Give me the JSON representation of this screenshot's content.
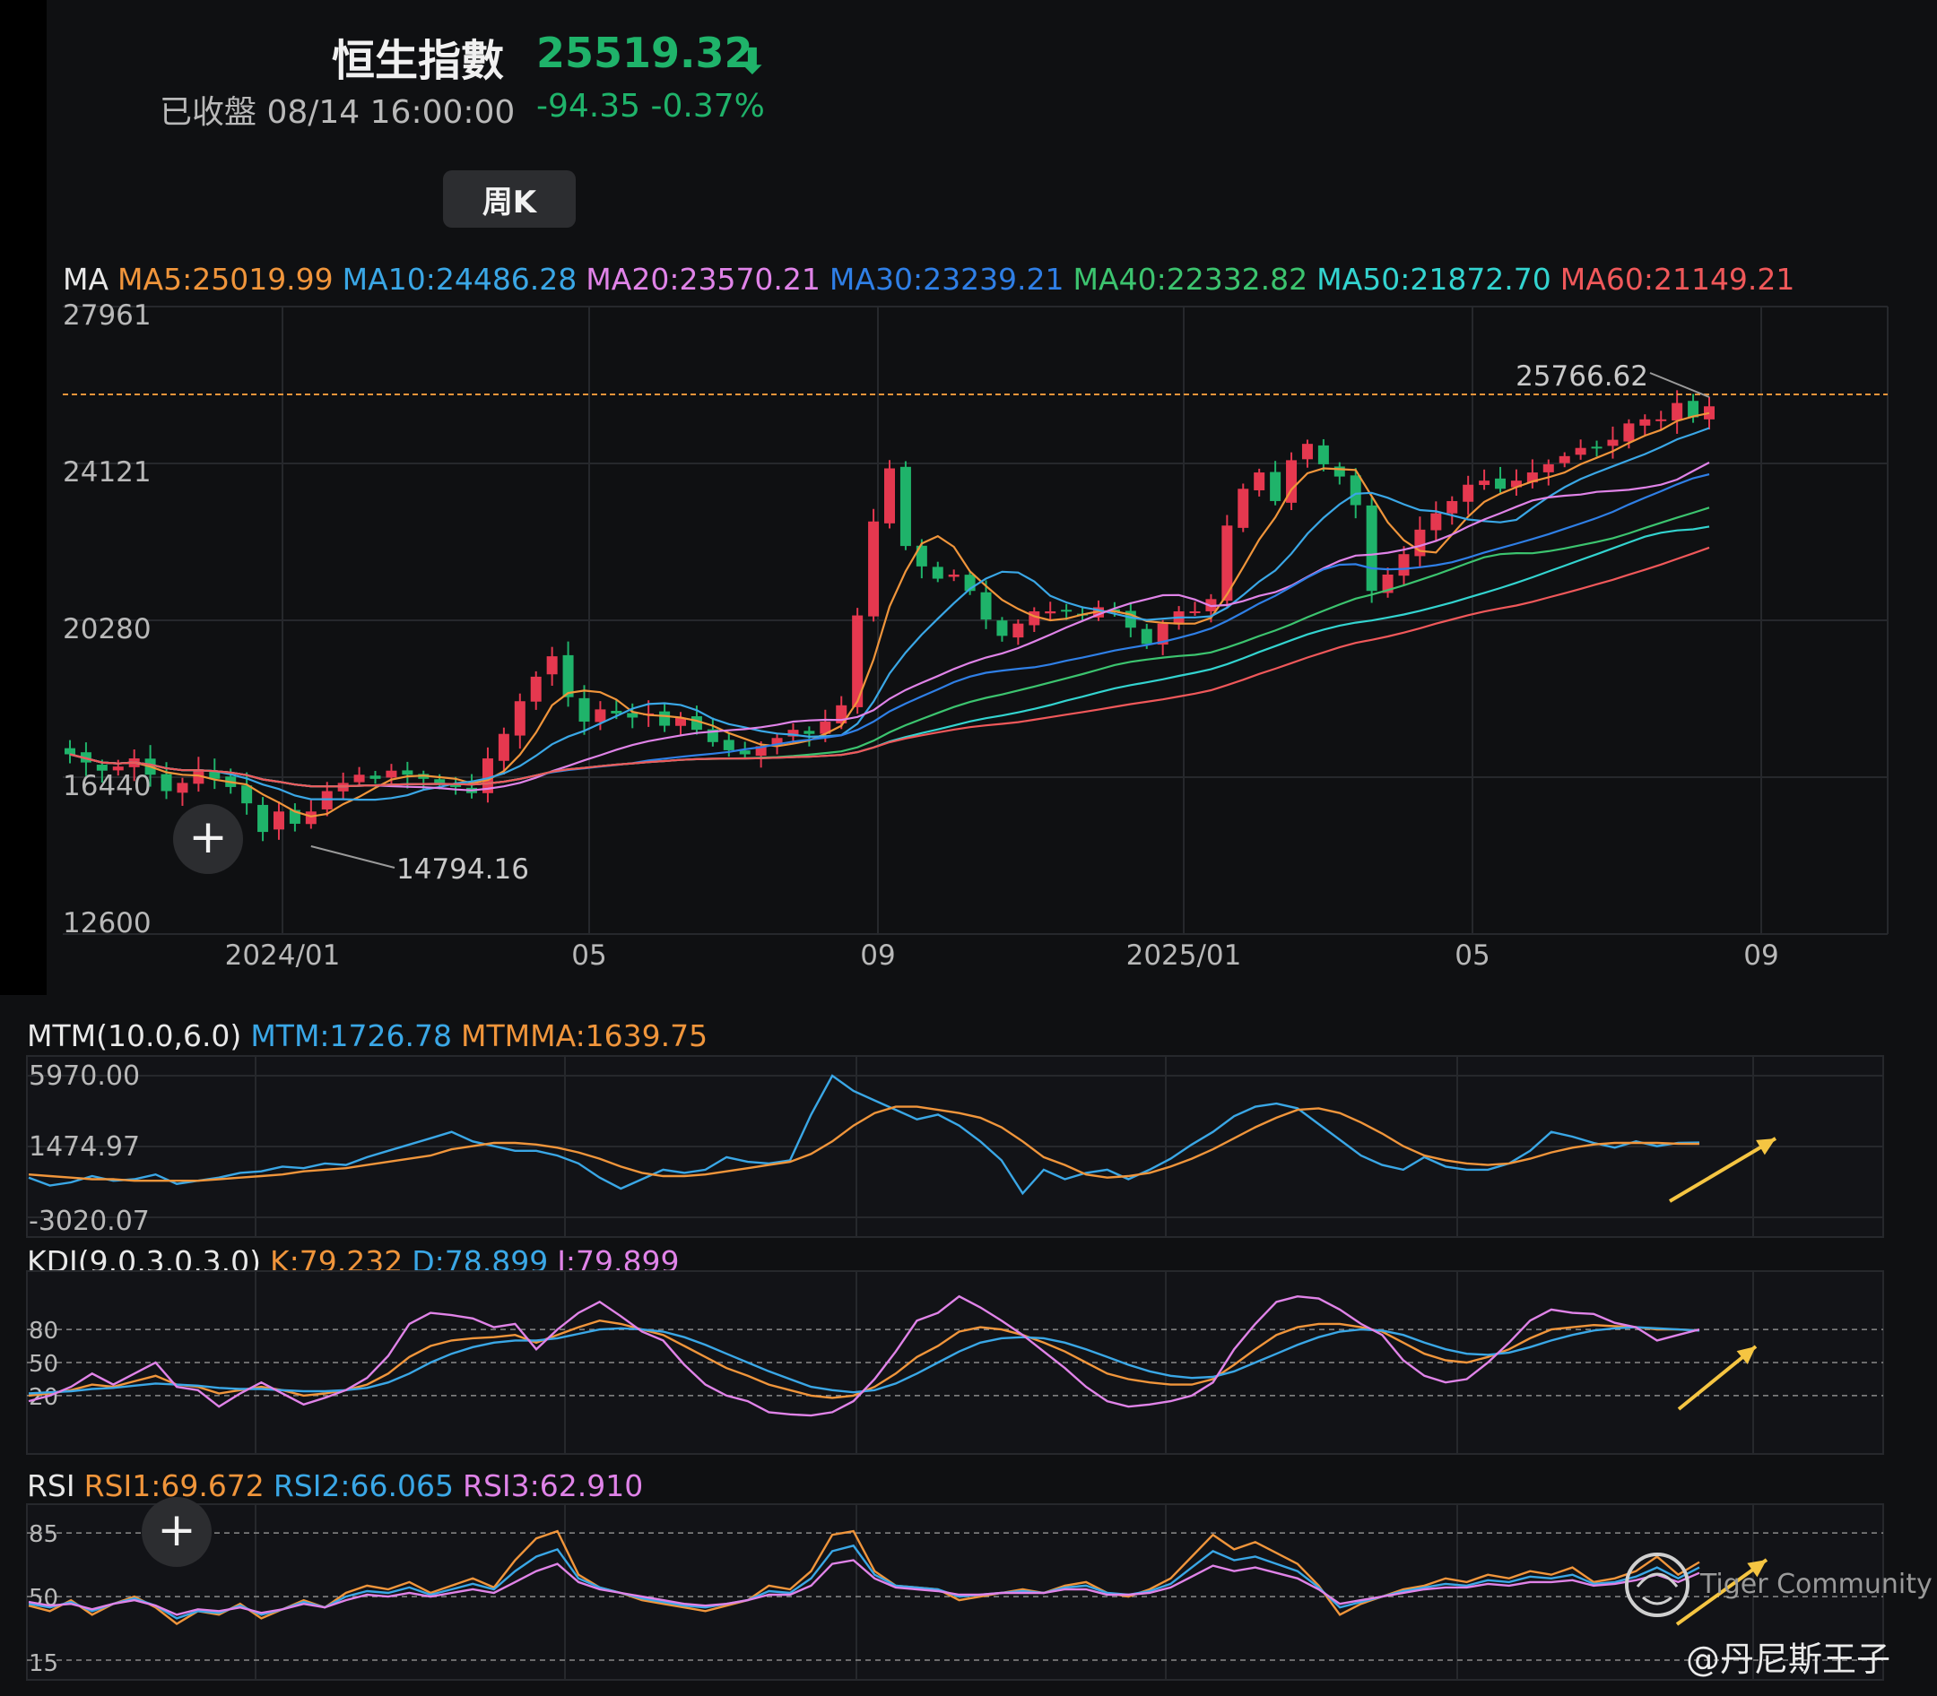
{
  "header": {
    "title": "恒生指數",
    "price": "25519.32",
    "status": "已收盤 08/14 16:00:00",
    "change": "-94.35 -0.37%"
  },
  "period_button": "周K",
  "ma_legend": {
    "label": "MA",
    "items": [
      {
        "text": "MA5:25019.99",
        "color": "#f0953b"
      },
      {
        "text": "MA10:24486.28",
        "color": "#3aa7e6"
      },
      {
        "text": "MA20:23570.21",
        "color": "#e083e8"
      },
      {
        "text": "MA30:23239.21",
        "color": "#2f7fe6"
      },
      {
        "text": "MA40:22332.82",
        "color": "#3cc46f"
      },
      {
        "text": "MA50:21872.70",
        "color": "#33d4d0"
      },
      {
        "text": "MA60:21149.21",
        "color": "#f0585a"
      }
    ]
  },
  "mtm_legend": {
    "label": "MTM(10.0,6.0)",
    "mtm": "MTM:1726.78",
    "mtmma": "MTMMA:1639.75"
  },
  "kdj_legend": {
    "label": "KDJ(9.0,3.0,3.0)",
    "k": "K:79.232",
    "d": "D:78.899",
    "j": "J:79.899"
  },
  "rsi_legend": {
    "label": "RSI",
    "rsi1": "RSI1:69.672",
    "rsi2": "RSI2:66.065",
    "rsi3": "RSI3:62.910"
  },
  "watermark": "Tiger Community",
  "handle": "@丹尼斯王子",
  "colors": {
    "up": "#e5384f",
    "down": "#1fb36a",
    "orange": "#f0953b",
    "blue": "#3aa7e6",
    "pink": "#e083e8",
    "arrow": "#f5c542"
  },
  "chart_data": [
    {
      "type": "candlestick",
      "title": "恒生指數 周K",
      "y_ticks": [
        "27961",
        "24121",
        "20280",
        "16440",
        "12600"
      ],
      "ylim": [
        12600,
        27961
      ],
      "x_ticks": [
        "2024/01",
        "05",
        "09",
        "2025/01",
        "05",
        "09"
      ],
      "annotations": {
        "high": "25766.62",
        "low": "14794.16"
      },
      "closes": [
        17000,
        16800,
        16600,
        16700,
        16900,
        16500,
        16100,
        16300,
        16600,
        16400,
        16200,
        15800,
        15100,
        15600,
        15300,
        15600,
        16100,
        16300,
        16500,
        16400,
        16600,
        16500,
        16400,
        16300,
        16200,
        16050,
        16900,
        17500,
        18300,
        18900,
        19400,
        18400,
        17800,
        18100,
        18000,
        17900,
        18000,
        17700,
        17900,
        17600,
        17300,
        17100,
        17000,
        17200,
        17400,
        17600,
        17500,
        17800,
        18200,
        20400,
        22700,
        24000,
        22100,
        21600,
        21300,
        21400,
        21000,
        20300,
        19900,
        20200,
        20500,
        20500,
        20500,
        20400,
        20600,
        20500,
        20100,
        19700,
        20200,
        20500,
        20500,
        20800,
        22600,
        23500,
        23900,
        23200,
        24200,
        24600,
        24100,
        23800,
        23100,
        21000,
        21400,
        21900,
        22500,
        22900,
        23200,
        23600,
        23700,
        23500,
        23700,
        23900,
        24100,
        24300,
        24500,
        24500,
        24700,
        25100,
        25200,
        25200,
        25600,
        25250,
        25519
      ]
    },
    {
      "type": "line",
      "title": "MTM(10.0,6.0)",
      "y_ticks": [
        "5970.00",
        "1474.97",
        "-3020.07"
      ],
      "ylim": [
        -3020.07,
        5970.0
      ],
      "series": [
        {
          "name": "MTM",
          "color": "#3aa7e6",
          "values": [
            -500,
            -1000,
            -800,
            -400,
            -700,
            -600,
            -300,
            -900,
            -700,
            -500,
            -200,
            -100,
            200,
            100,
            400,
            300,
            800,
            1200,
            1600,
            2000,
            2400,
            1800,
            1500,
            1200,
            1200,
            900,
            400,
            -500,
            -1200,
            -600,
            0,
            -200,
            0,
            800,
            500,
            400,
            600,
            3500,
            5970,
            5000,
            4400,
            3800,
            3200,
            3500,
            2800,
            1800,
            600,
            -1500,
            0,
            -600,
            -200,
            0,
            -600,
            0,
            700,
            1600,
            2400,
            3400,
            4000,
            4200,
            3900,
            2900,
            1900,
            900,
            300,
            0,
            800,
            200,
            0,
            0,
            400,
            1200,
            2400,
            2100,
            1700,
            1400,
            1800,
            1500,
            1700,
            1726
          ]
        },
        {
          "name": "MTMMA",
          "color": "#f0953b",
          "values": [
            -300,
            -400,
            -500,
            -600,
            -600,
            -700,
            -700,
            -700,
            -700,
            -600,
            -500,
            -400,
            -300,
            -100,
            0,
            100,
            300,
            500,
            700,
            900,
            1300,
            1500,
            1700,
            1700,
            1600,
            1400,
            1100,
            700,
            200,
            -200,
            -400,
            -400,
            -300,
            -100,
            100,
            300,
            500,
            1000,
            1800,
            2800,
            3600,
            4000,
            4000,
            3800,
            3600,
            3300,
            2700,
            1800,
            800,
            300,
            -300,
            -500,
            -400,
            -200,
            200,
            700,
            1300,
            2000,
            2700,
            3300,
            3800,
            3900,
            3600,
            3000,
            2300,
            1500,
            900,
            600,
            400,
            300,
            400,
            700,
            1100,
            1400,
            1600,
            1700,
            1700,
            1700,
            1650,
            1640
          ]
        }
      ]
    },
    {
      "type": "line",
      "title": "KDJ(9.0,3.0,3.0)",
      "y_ticks": [
        "80",
        "50",
        "20"
      ],
      "ylim": [
        -15,
        115
      ],
      "series": [
        {
          "name": "K",
          "color": "#f0953b",
          "values": [
            20,
            22,
            25,
            30,
            28,
            33,
            38,
            30,
            28,
            22,
            25,
            28,
            25,
            20,
            22,
            25,
            30,
            40,
            55,
            65,
            70,
            72,
            73,
            75,
            68,
            75,
            82,
            88,
            85,
            80,
            75,
            65,
            55,
            45,
            38,
            30,
            25,
            20,
            18,
            20,
            28,
            40,
            55,
            65,
            78,
            82,
            80,
            75,
            68,
            60,
            50,
            40,
            35,
            32,
            30,
            30,
            35,
            48,
            62,
            75,
            82,
            85,
            85,
            82,
            78,
            68,
            58,
            52,
            50,
            55,
            62,
            72,
            80,
            82,
            84,
            83,
            82,
            80,
            80,
            79
          ]
        },
        {
          "name": "D",
          "color": "#3aa7e6",
          "values": [
            22,
            23,
            24,
            26,
            27,
            29,
            31,
            30,
            29,
            27,
            26,
            26,
            25,
            24,
            24,
            25,
            27,
            32,
            40,
            50,
            58,
            64,
            68,
            70,
            70,
            72,
            76,
            80,
            81,
            80,
            78,
            73,
            66,
            58,
            50,
            42,
            35,
            28,
            25,
            23,
            25,
            31,
            40,
            50,
            60,
            68,
            72,
            73,
            72,
            68,
            62,
            55,
            48,
            42,
            38,
            36,
            37,
            42,
            50,
            58,
            66,
            73,
            78,
            80,
            79,
            75,
            68,
            62,
            58,
            57,
            59,
            64,
            70,
            75,
            79,
            81,
            82,
            81,
            80,
            79
          ]
        },
        {
          "name": "J",
          "color": "#e083e8",
          "values": [
            15,
            20,
            28,
            40,
            30,
            40,
            50,
            28,
            25,
            10,
            22,
            32,
            22,
            12,
            18,
            25,
            36,
            56,
            85,
            95,
            93,
            90,
            82,
            85,
            62,
            80,
            95,
            105,
            92,
            78,
            70,
            48,
            30,
            20,
            15,
            5,
            3,
            2,
            5,
            15,
            35,
            60,
            88,
            95,
            110,
            100,
            88,
            75,
            60,
            45,
            28,
            15,
            10,
            12,
            15,
            20,
            32,
            62,
            85,
            105,
            110,
            108,
            98,
            85,
            75,
            52,
            38,
            32,
            35,
            50,
            68,
            88,
            98,
            95,
            94,
            86,
            82,
            70,
            75,
            80
          ]
        }
      ]
    },
    {
      "type": "line",
      "title": "RSI",
      "y_ticks": [
        "85",
        "50",
        "15"
      ],
      "ylim": [
        15,
        90
      ],
      "series": [
        {
          "name": "RSI1",
          "color": "#f0953b",
          "values": [
            45,
            42,
            48,
            40,
            46,
            50,
            44,
            35,
            42,
            40,
            46,
            38,
            43,
            48,
            44,
            52,
            56,
            54,
            58,
            52,
            56,
            60,
            55,
            70,
            82,
            86,
            62,
            55,
            52,
            48,
            46,
            44,
            42,
            45,
            48,
            56,
            54,
            64,
            84,
            86,
            64,
            56,
            55,
            54,
            48,
            50,
            52,
            54,
            52,
            56,
            58,
            52,
            50,
            54,
            60,
            72,
            84,
            76,
            80,
            74,
            68,
            56,
            40,
            46,
            50,
            54,
            56,
            60,
            58,
            62,
            60,
            64,
            62,
            66,
            58,
            60,
            64,
            72,
            62,
            69
          ]
        },
        {
          "name": "RSI2",
          "color": "#3aa7e6",
          "values": [
            46,
            44,
            47,
            42,
            46,
            49,
            45,
            38,
            42,
            41,
            45,
            40,
            43,
            47,
            44,
            50,
            53,
            52,
            55,
            51,
            54,
            57,
            54,
            64,
            72,
            76,
            60,
            55,
            52,
            49,
            47,
            45,
            44,
            46,
            48,
            53,
            52,
            60,
            75,
            78,
            62,
            56,
            55,
            54,
            50,
            51,
            52,
            53,
            52,
            55,
            56,
            52,
            51,
            53,
            57,
            66,
            75,
            70,
            72,
            68,
            64,
            55,
            44,
            47,
            50,
            53,
            55,
            57,
            56,
            59,
            58,
            61,
            60,
            62,
            57,
            58,
            61,
            66,
            60,
            66
          ]
        },
        {
          "name": "RSI3",
          "color": "#e083e8",
          "values": [
            47,
            45,
            46,
            43,
            46,
            48,
            45,
            40,
            43,
            42,
            44,
            41,
            43,
            46,
            44,
            48,
            51,
            50,
            52,
            50,
            52,
            54,
            52,
            58,
            64,
            68,
            58,
            54,
            52,
            50,
            48,
            46,
            45,
            46,
            48,
            51,
            51,
            56,
            68,
            70,
            60,
            55,
            54,
            53,
            51,
            51,
            52,
            52,
            52,
            54,
            54,
            51,
            51,
            52,
            55,
            61,
            67,
            64,
            66,
            63,
            60,
            54,
            46,
            48,
            50,
            52,
            54,
            55,
            55,
            57,
            56,
            58,
            58,
            59,
            56,
            57,
            59,
            62,
            58,
            63
          ]
        }
      ]
    }
  ]
}
